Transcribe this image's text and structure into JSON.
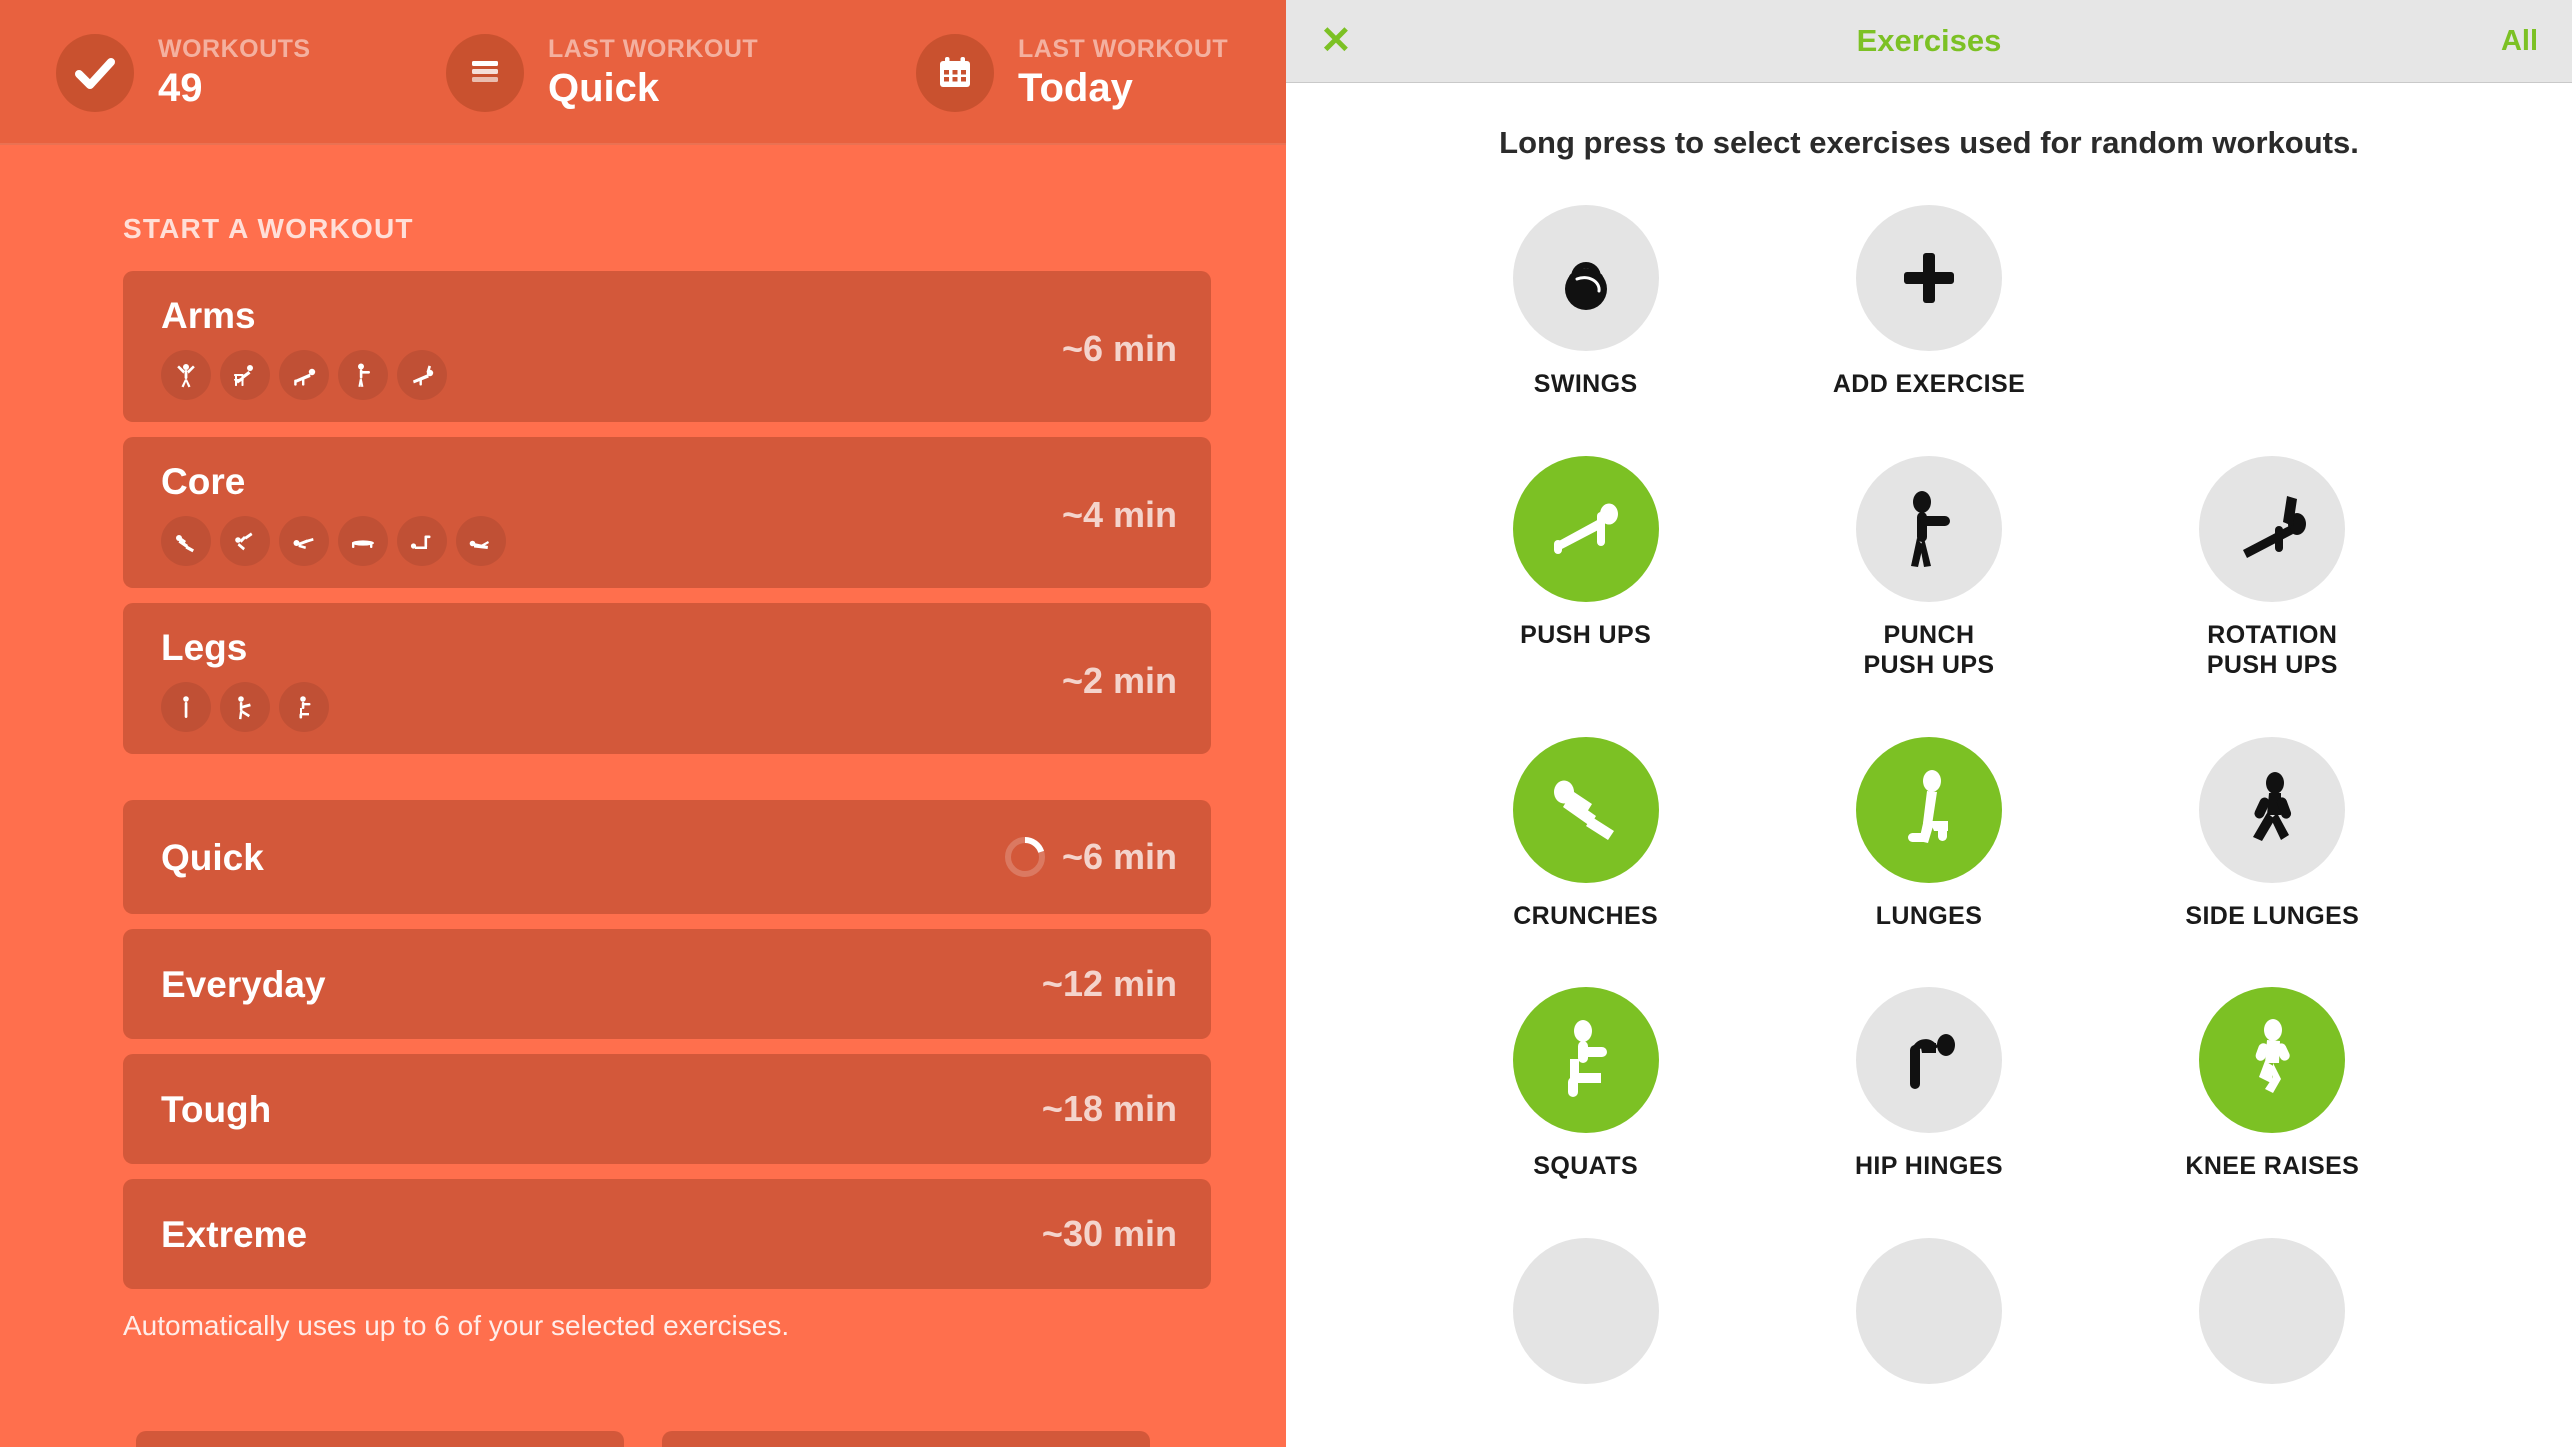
{
  "theme": {
    "left_bg": "#FF6F4D",
    "left_header_bg": "#E8613F",
    "card_bg": "#D3583A",
    "accent_green": "#7CC124",
    "bubble_gray": "#E4E4E4",
    "header_gray": "#E6E6E6"
  },
  "left": {
    "stats": [
      {
        "icon": "check-icon",
        "label": "WORKOUTS",
        "value": "49"
      },
      {
        "icon": "list-icon",
        "label": "LAST WORKOUT",
        "value": "Quick"
      },
      {
        "icon": "calendar-icon",
        "label": "LAST WORKOUT",
        "value": "Today"
      }
    ],
    "section_title": "START A WORKOUT",
    "groups": [
      {
        "name": "Arms",
        "time": "~6 min",
        "icons": [
          "jumping-jacks-icon",
          "chair-dips-icon",
          "push-ups-icon",
          "punch-icon",
          "rotation-push-ups-icon"
        ]
      },
      {
        "name": "Core",
        "time": "~4 min",
        "icons": [
          "crunches-icon",
          "leg-raises-icon",
          "v-ups-icon",
          "plank-icon",
          "bridge-icon",
          "superman-icon"
        ]
      },
      {
        "name": "Legs",
        "time": "~2 min",
        "icons": [
          "standing-icon",
          "kick-icon",
          "squats-icon"
        ]
      }
    ],
    "presets": [
      {
        "name": "Quick",
        "time": "~6 min",
        "has_ring": true,
        "ring_percent": 20
      },
      {
        "name": "Everyday",
        "time": "~12 min",
        "has_ring": false,
        "ring_percent": 0
      },
      {
        "name": "Tough",
        "time": "~18 min",
        "has_ring": false,
        "ring_percent": 0
      },
      {
        "name": "Extreme",
        "time": "~30 min",
        "has_ring": false,
        "ring_percent": 0
      }
    ],
    "footnote": "Automatically uses up to 6 of your selected exercises."
  },
  "right": {
    "close_icon": "close-icon",
    "title": "Exercises",
    "all_label": "All",
    "hint": "Long press to select exercises used for random workouts.",
    "exercises": [
      {
        "label": "SWINGS",
        "icon": "kettlebell-icon",
        "selected": false
      },
      {
        "label": "ADD EXERCISE",
        "icon": "plus-icon",
        "selected": false
      },
      {
        "label": "",
        "icon": "empty-icon",
        "selected": false
      },
      {
        "label": "PUSH UPS",
        "icon": "push-ups-icon",
        "selected": true
      },
      {
        "label": "PUNCH\nPUSH UPS",
        "icon": "punch-push-ups-icon",
        "selected": false
      },
      {
        "label": "ROTATION\nPUSH UPS",
        "icon": "rotation-push-ups-icon",
        "selected": false
      },
      {
        "label": "CRUNCHES",
        "icon": "crunches-icon",
        "selected": true
      },
      {
        "label": "LUNGES",
        "icon": "lunges-icon",
        "selected": true
      },
      {
        "label": "SIDE LUNGES",
        "icon": "side-lunges-icon",
        "selected": false
      },
      {
        "label": "SQUATS",
        "icon": "squats-icon",
        "selected": true
      },
      {
        "label": "HIP HINGES",
        "icon": "hip-hinges-icon",
        "selected": false
      },
      {
        "label": "KNEE RAISES",
        "icon": "knee-raises-icon",
        "selected": true
      }
    ]
  }
}
